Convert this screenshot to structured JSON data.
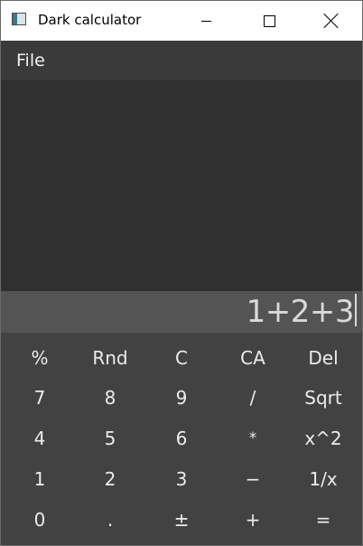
{
  "window": {
    "title": "Dark calculator",
    "controls": {
      "minimize": "minimize",
      "maximize": "maximize",
      "close": "close"
    }
  },
  "menu": {
    "file": "File"
  },
  "display": {
    "expression": "1+2+3"
  },
  "keypad": {
    "rows": [
      [
        "%",
        "Rnd",
        "C",
        "CA",
        "Del"
      ],
      [
        "7",
        "8",
        "9",
        "/",
        "Sqrt"
      ],
      [
        "4",
        "5",
        "6",
        "*",
        "x^2"
      ],
      [
        "1",
        "2",
        "3",
        "−",
        "1/x"
      ],
      [
        "0",
        ".",
        "±",
        "+",
        "="
      ]
    ]
  },
  "colors": {
    "menubar": "#3a3a3a",
    "history": "#303030",
    "display": "#545454",
    "keypad": "#424242",
    "text": "#ececec"
  }
}
